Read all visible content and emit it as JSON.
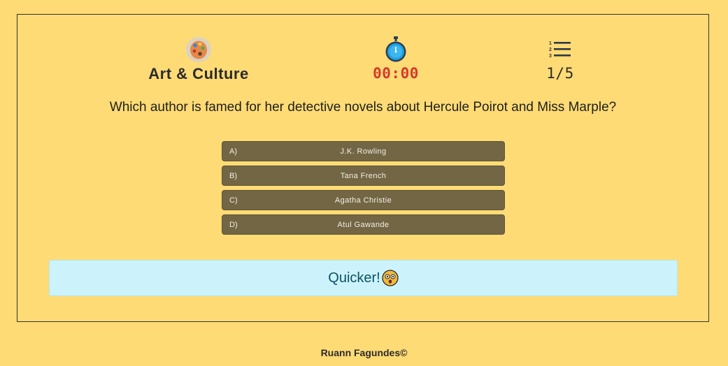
{
  "header": {
    "category": {
      "icon": "palette-icon",
      "label": "Art & Culture"
    },
    "timer": {
      "icon": "stopwatch-icon",
      "value": "00:00"
    },
    "progress": {
      "icon": "numbered-list-icon",
      "value": "1/5"
    }
  },
  "question": {
    "text": "Which author is famed for her detective novels about Hercule Poirot and Miss Marple?"
  },
  "answers": [
    {
      "letter": "A)",
      "text": "J.K. Rowling"
    },
    {
      "letter": "B)",
      "text": "Tana French"
    },
    {
      "letter": "C)",
      "text": "Agatha Christie"
    },
    {
      "letter": "D)",
      "text": "Atul Gawande"
    }
  ],
  "feedback": {
    "text": "Quicker!",
    "icon": "astonished-face-icon"
  },
  "footer": {
    "credit": "Ruann Fagundes©"
  },
  "colors": {
    "background": "#ffdb75",
    "answer_button": "#726645",
    "timer_text": "#d33a2c",
    "feedback_bg": "#ccf3fb",
    "feedback_text": "#0d5262"
  }
}
